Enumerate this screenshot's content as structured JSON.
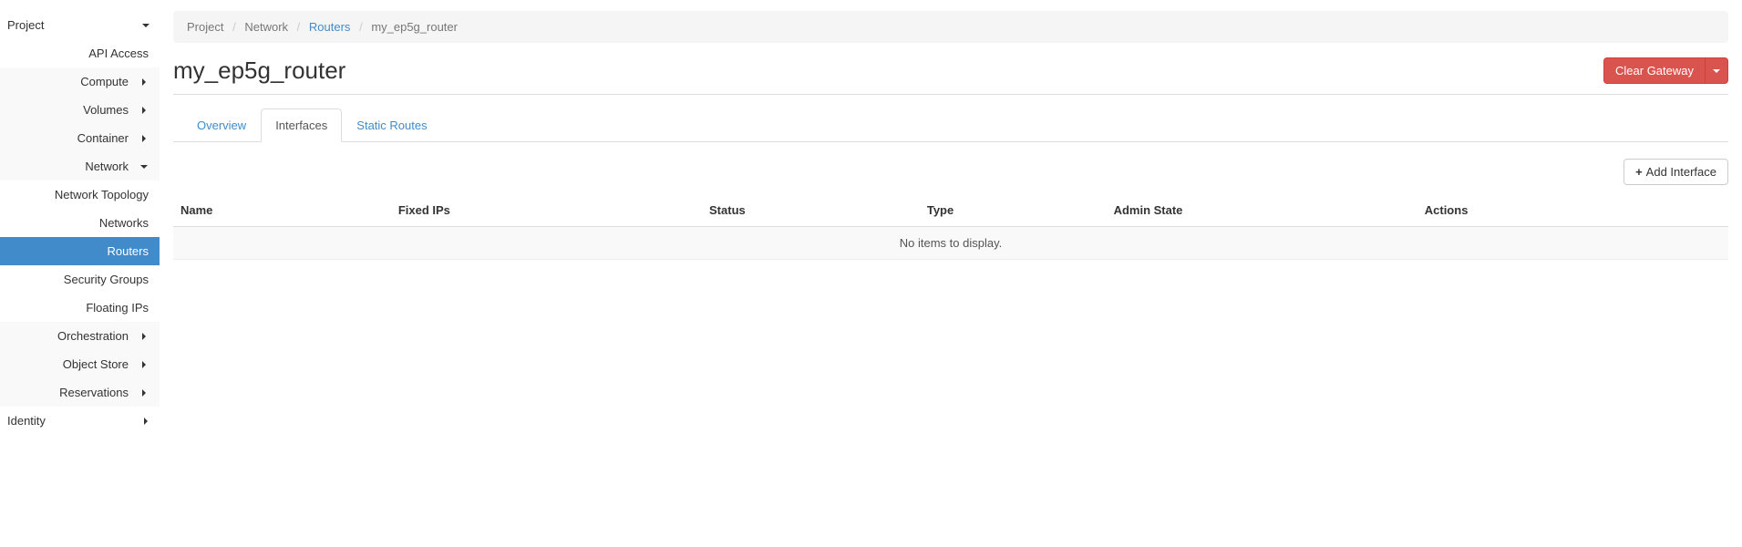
{
  "sidebar": {
    "project": "Project",
    "api_access": "API Access",
    "compute": "Compute",
    "volumes": "Volumes",
    "container": "Container",
    "network": "Network",
    "network_children": {
      "topology": "Network Topology",
      "networks": "Networks",
      "routers": "Routers",
      "security_groups": "Security Groups",
      "floating_ips": "Floating IPs"
    },
    "orchestration": "Orchestration",
    "object_store": "Object Store",
    "reservations": "Reservations",
    "identity": "Identity"
  },
  "breadcrumb": {
    "project": "Project",
    "network": "Network",
    "routers": "Routers",
    "current": "my_ep5g_router"
  },
  "page": {
    "title": "my_ep5g_router",
    "clear_gateway": "Clear Gateway"
  },
  "tabs": {
    "overview": "Overview",
    "interfaces": "Interfaces",
    "static_routes": "Static Routes"
  },
  "toolbar": {
    "add_interface": "Add Interface"
  },
  "table": {
    "headers": {
      "name": "Name",
      "fixed_ips": "Fixed IPs",
      "status": "Status",
      "type": "Type",
      "admin_state": "Admin State",
      "actions": "Actions"
    },
    "empty": "No items to display."
  }
}
